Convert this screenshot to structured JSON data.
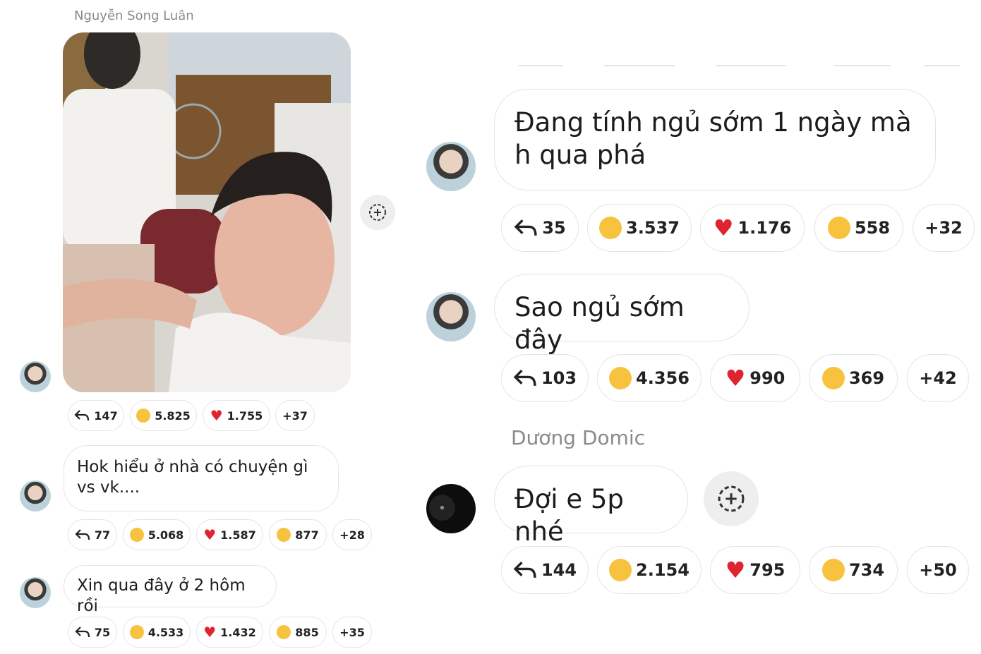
{
  "left": {
    "sender_name": "Nguyễn Song Luân",
    "photo_reactions": [
      {
        "icon": "reply-icon",
        "count": "147"
      },
      {
        "icon": "laughing-tears-emoji",
        "count": "5.825"
      },
      {
        "icon": "heart-emoji",
        "count": "1.755"
      },
      {
        "icon": "more",
        "count": "+37"
      }
    ],
    "messages": [
      {
        "text": "Hok hiểu ở nhà có chuyện gì vs vk....",
        "reactions": [
          {
            "icon": "reply-icon",
            "count": "77"
          },
          {
            "icon": "laughing-tears-emoji",
            "count": "5.068"
          },
          {
            "icon": "heart-emoji",
            "count": "1.587"
          },
          {
            "icon": "grinning-squint-emoji",
            "count": "877"
          },
          {
            "icon": "more",
            "count": "+28"
          }
        ]
      },
      {
        "text": "Xin qua đây ở 2 hôm rồi",
        "reactions": [
          {
            "icon": "reply-icon",
            "count": "75"
          },
          {
            "icon": "laughing-tears-emoji",
            "count": "4.533"
          },
          {
            "icon": "heart-emoji",
            "count": "1.432"
          },
          {
            "icon": "grinning-squint-emoji",
            "count": "885"
          },
          {
            "icon": "more",
            "count": "+35"
          }
        ]
      }
    ]
  },
  "right": {
    "messages": [
      {
        "text": "Đang tính ngủ sớm 1 ngày mà h qua phá",
        "reactions": [
          {
            "icon": "reply-icon",
            "count": "35"
          },
          {
            "icon": "laughing-tears-emoji",
            "count": "3.537"
          },
          {
            "icon": "heart-emoji",
            "count": "1.176"
          },
          {
            "icon": "rolling-laughing-emoji",
            "count": "558"
          },
          {
            "icon": "more",
            "count": "+32"
          }
        ]
      },
      {
        "text": "Sao ngủ sớm đây",
        "reactions": [
          {
            "icon": "reply-icon",
            "count": "103"
          },
          {
            "icon": "laughing-tears-emoji",
            "count": "4.356"
          },
          {
            "icon": "heart-emoji",
            "count": "990"
          },
          {
            "icon": "hugging-emoji",
            "count": "369"
          },
          {
            "icon": "more",
            "count": "+42"
          }
        ]
      }
    ],
    "second_sender_name": "Dương Domic",
    "last_message": {
      "text": "Đợi e 5p nhé",
      "reactions": [
        {
          "icon": "reply-icon",
          "count": "144"
        },
        {
          "icon": "laughing-tears-emoji",
          "count": "2.154"
        },
        {
          "icon": "heart-emoji",
          "count": "795"
        },
        {
          "icon": "grinning-squint-emoji",
          "count": "734"
        },
        {
          "icon": "more",
          "count": "+50"
        }
      ]
    }
  },
  "colors": {
    "bubble_border": "#e4e4e4",
    "heart": "#e0242f",
    "emoji": "#f7c23d",
    "sender": "#8a8a8a"
  }
}
